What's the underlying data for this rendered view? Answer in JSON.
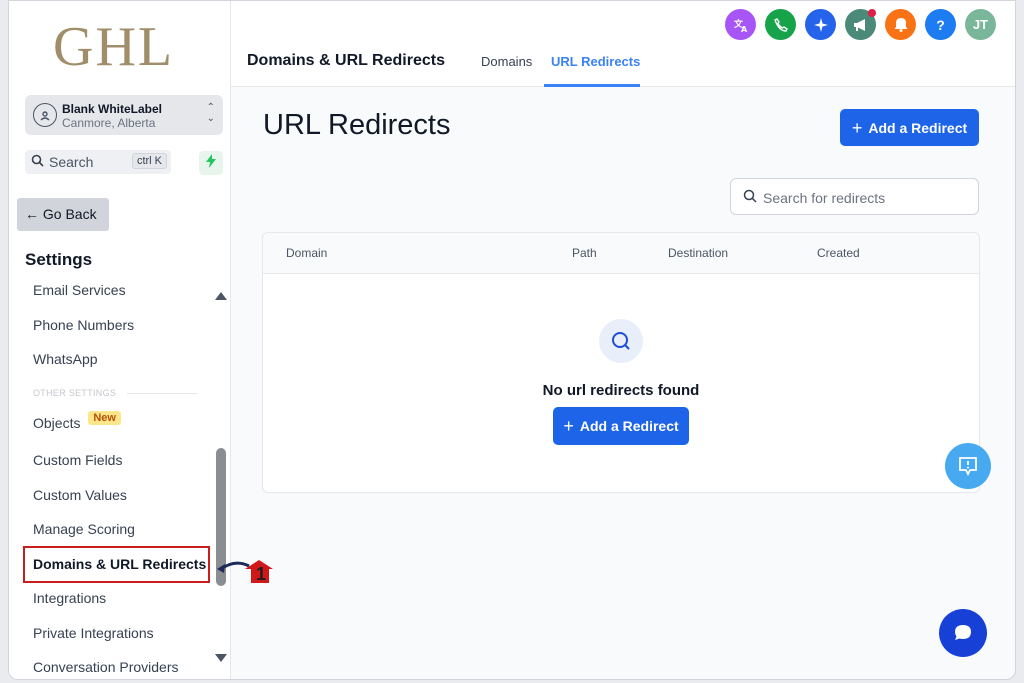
{
  "logo": {
    "text": "GHL"
  },
  "account": {
    "name": "Blank WhiteLabel",
    "location": "Canmore, Alberta"
  },
  "sidebar_search": {
    "placeholder": "Search",
    "shortcut": "ctrl K"
  },
  "go_back_label": "Go Back",
  "settings_title": "Settings",
  "nav_top": [
    "Email Services",
    "Phone Numbers",
    "WhatsApp"
  ],
  "section_label": "OTHER SETTINGS",
  "nav_other": [
    {
      "label": "Objects",
      "badge": "New"
    },
    {
      "label": "Custom Fields"
    },
    {
      "label": "Custom Values"
    },
    {
      "label": "Manage Scoring"
    },
    {
      "label": "Domains & URL Redirects",
      "active": true
    },
    {
      "label": "Integrations"
    },
    {
      "label": "Private Integrations"
    },
    {
      "label": "Conversation Providers"
    }
  ],
  "annotation_number": "1",
  "header": {
    "title": "Domains & URL Redirects",
    "tabs": [
      {
        "label": "Domains",
        "active": false
      },
      {
        "label": "URL Redirects",
        "active": true
      }
    ]
  },
  "top_icons": [
    {
      "name": "translate-icon",
      "color": "#a855f7"
    },
    {
      "name": "phone-icon",
      "color": "#16a34a"
    },
    {
      "name": "sparkle-icon",
      "color": "#2563eb"
    },
    {
      "name": "megaphone-icon",
      "color": "#4b8a78",
      "dot": true
    },
    {
      "name": "bell-icon",
      "color": "#f97316"
    },
    {
      "name": "help-icon",
      "color": "#1d7cf2",
      "text": "?"
    },
    {
      "name": "user-avatar",
      "color": "#7ab79a",
      "text": "JT"
    }
  ],
  "page_title": "URL Redirects",
  "add_redirect_label": "Add a Redirect",
  "redirect_search_placeholder": "Search for redirects",
  "table": {
    "columns": [
      "Domain",
      "Path",
      "Destination",
      "Created"
    ],
    "empty_message": "No url redirects found",
    "empty_button": "Add a Redirect"
  },
  "colors": {
    "primary": "#1d64e8",
    "accent": "#3b82f6",
    "highlight": "#c81e1e"
  }
}
